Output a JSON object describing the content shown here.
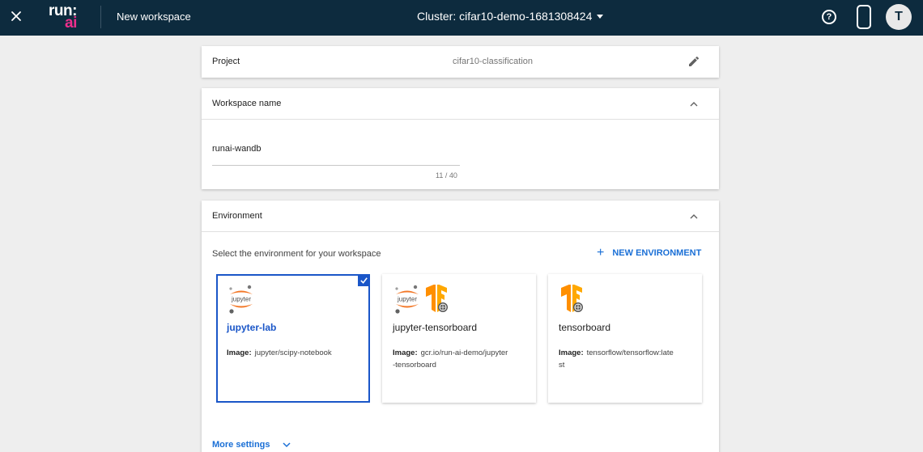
{
  "topbar": {
    "logo_top": "run:",
    "logo_bottom": "ai",
    "title": "New workspace",
    "cluster_label": "Cluster: cifar10-demo-1681308424",
    "help_symbol": "?",
    "avatar_initial": "T"
  },
  "project": {
    "label": "Project",
    "value": "cifar10-classification"
  },
  "workspace_name": {
    "title": "Workspace name",
    "value": "runai-wandb",
    "counter": "11 / 40"
  },
  "environment": {
    "title": "Environment",
    "prompt": "Select the environment for your workspace",
    "new_button": "NEW ENVIRONMENT",
    "image_label": "Image:",
    "cards": [
      {
        "name": "jupyter-lab",
        "image_line1": "jupyter/scipy-notebook",
        "image_line2": "",
        "selected": true,
        "icons": [
          "jupyter-icon"
        ]
      },
      {
        "name": "jupyter-tensorboard",
        "image_line1": "gcr.io/run-ai-demo/jupyter",
        "image_line2": "-tensorboard",
        "selected": false,
        "icons": [
          "jupyter-icon",
          "tensorflow-icon"
        ]
      },
      {
        "name": "tensorboard",
        "image_line1": "tensorflow/tensorflow:late",
        "image_line2": "st",
        "selected": false,
        "icons": [
          "tensorflow-icon"
        ]
      }
    ],
    "more_settings": "More settings"
  },
  "colors": {
    "topbar_bg": "#0d2b3e",
    "accent": "#1a6fd6",
    "selected": "#1a56c8",
    "logo_pink": "#ee2f8c",
    "jupyter_orange": "#f37726",
    "tensorflow_orange": "#ff8f00"
  }
}
